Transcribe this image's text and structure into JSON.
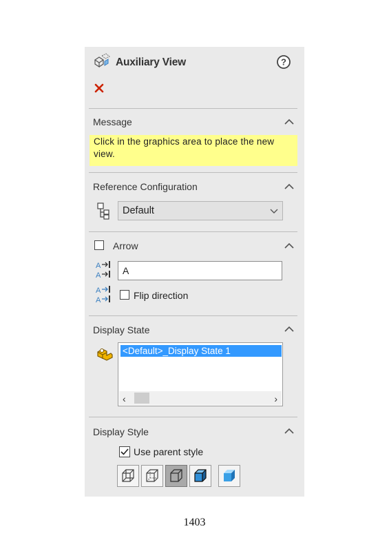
{
  "header": {
    "title": "Auxiliary View"
  },
  "sections": {
    "message": {
      "title": "Message",
      "text": "Click in the graphics area to place the new view."
    },
    "reference_configuration": {
      "title": "Reference Configuration",
      "selected": "Default"
    },
    "arrow": {
      "title": "Arrow",
      "label_value": "A",
      "flip_label": "Flip direction"
    },
    "display_state": {
      "title": "Display State",
      "items": [
        "<Default>_Display State 1"
      ]
    },
    "display_style": {
      "title": "Display Style",
      "use_parent_label": "Use parent style",
      "buttons": [
        "wireframe",
        "hidden-lines-visible",
        "hidden-lines-removed",
        "shaded-with-edges",
        "shaded"
      ]
    }
  },
  "colors": {
    "message_bg": "#ffff8c",
    "selection": "#3399ff",
    "close": "#cc2200",
    "panel_bg": "#eaeaea"
  },
  "page": {
    "number": "1403"
  }
}
